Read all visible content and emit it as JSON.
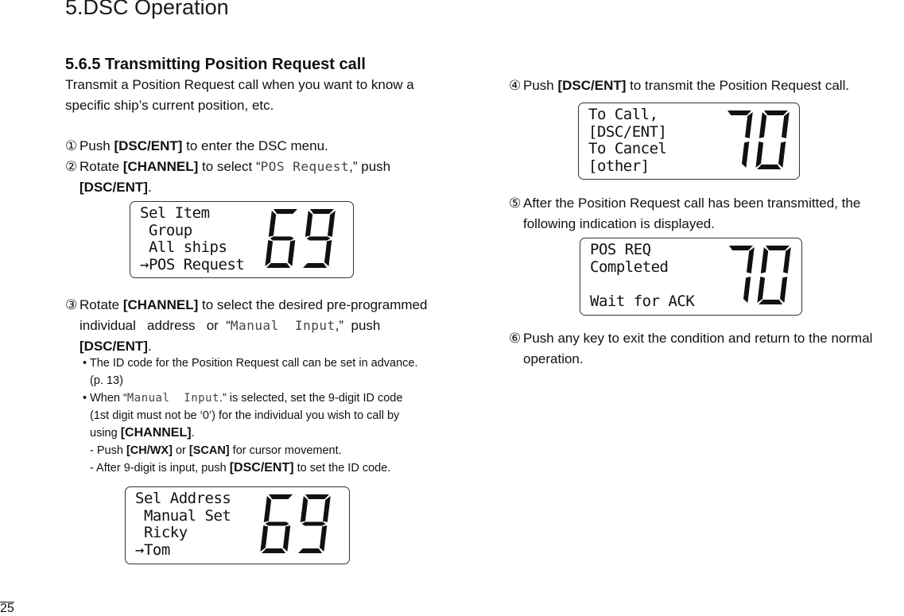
{
  "chapter_title": "5.DSC Operation",
  "section_title": "5.6.5 Transmitting Position Request call",
  "intro": [
    "Transmit a Position Request call when you want to know a",
    "specific ship’s current position, etc."
  ],
  "steps": {
    "s1": {
      "num": "①",
      "pre": "Push ",
      "key": "[DSC/ENT]",
      "post": " to enter the DSC menu."
    },
    "s2": {
      "num": "②",
      "pre": "Rotate ",
      "key": "[CHANNEL]",
      "mid": " to select “",
      "lcd": "POS Request",
      "post": ",” push",
      "key2": "[DSC/ENT]",
      "end": "."
    },
    "s3": {
      "num": "③",
      "pre": "Rotate ",
      "key": "[CHANNEL]",
      "post": " to select the desired pre-programmed",
      "line2a": "individual   address   or  “",
      "lcd": "Manual  Input",
      "line2b": ",”  push",
      "key2": "[DSC/ENT]",
      "end": ".",
      "bullets": {
        "b1a": "• The ID code for the Position Request call can be set in advance.",
        "b1b": "(p. 13)",
        "b2a_pre": "• When “",
        "b2a_lcd": "Manual  Input",
        "b2a_post": ".” is selected, set the 9-digit ID code",
        "b2b": "(1st digit must not be ‘0’) for the individual you wish to call by",
        "b2c_pre": "using ",
        "b2c_key": "[CHANNEL]",
        "b2c_end": ".",
        "d1_pre": "- Push ",
        "d1_key1": "[CH/WX]",
        "d1_mid": " or ",
        "d1_key2": "[SCAN]",
        "d1_post": " for cursor movement.",
        "d2_pre": "- After 9-digit is input, push ",
        "d2_key": "[DSC/ENT]",
        "d2_post": " to set the ID code."
      }
    },
    "s4": {
      "num": "④",
      "pre": "Push ",
      "key": "[DSC/ENT]",
      "post": " to transmit the Position Request call."
    },
    "s5": {
      "num": "⑤",
      "line1": "After the Position Request call has been transmitted, the",
      "line2": "following indication is displayed."
    },
    "s6": {
      "num": "⑥",
      "line1": "Push any key to exit the condition and return to the normal",
      "line2": "operation."
    }
  },
  "displays": {
    "d1": {
      "lines": [
        "Sel Item",
        " Group",
        " All ships",
        "→POS Request"
      ],
      "channel": "69"
    },
    "d2": {
      "lines": [
        "Sel Address",
        " Manual Set",
        " Ricky",
        "→Tom"
      ],
      "channel": "69"
    },
    "d3": {
      "lines": [
        "To Call,",
        "[DSC/ENT]",
        "To Cancel",
        "[other]"
      ],
      "channel": "70"
    },
    "d4": {
      "lines": [
        "POS REQ",
        "Completed",
        "",
        "Wait for ACK"
      ],
      "channel": "70"
    }
  },
  "page_number": "25"
}
